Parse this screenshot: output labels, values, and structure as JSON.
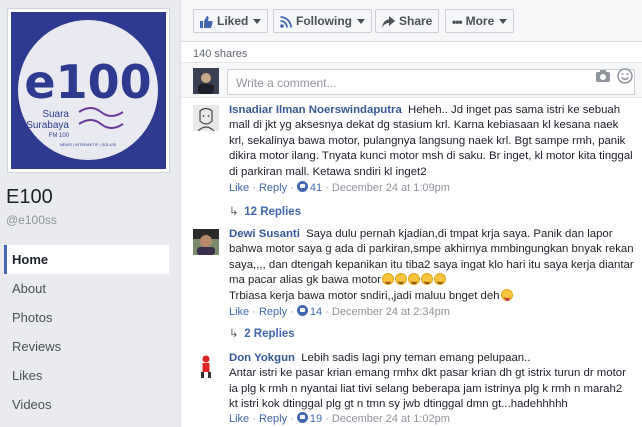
{
  "page": {
    "name": "E100",
    "handle": "@e100ss",
    "logo_text": "e100",
    "logo_sub1": "Suara",
    "logo_sub2": "Surabaya",
    "logo_fm": "FM 100",
    "logo_tag": "NEWS | INTERAKTIF | SOLUSI"
  },
  "nav": {
    "items": [
      {
        "label": "Home",
        "active": true
      },
      {
        "label": "About"
      },
      {
        "label": "Photos"
      },
      {
        "label": "Reviews"
      },
      {
        "label": "Likes"
      },
      {
        "label": "Videos"
      }
    ]
  },
  "actions": {
    "liked": "Liked",
    "following": "Following",
    "share": "Share",
    "more": "More"
  },
  "shares": "140 shares",
  "composer": {
    "placeholder": "Write a comment..."
  },
  "comments": [
    {
      "author": "Isnadiar Ilman Noerswindaputra",
      "text": "Heheh.. Jd inget pas sama istri ke sebuah mall di jkt yg aksesnya dekat dg stasium krl. Karna kebiasaan kl kesana naek krl, sekalinya bawa motor, pulangnya langsung naek krl. Bgt sampe rmh, panik dikira motor ilang. Tnyata kunci motor msh di saku. Br inget, kl motor kita tinggal di parkiran mall. Ketawa sndiri kl inget2",
      "like": "Like",
      "reply": "Reply",
      "likes": "41",
      "date": "December 24 at 1:09pm",
      "replies": "12 Replies"
    },
    {
      "author": "Dewi Susanti",
      "text": "Saya dulu pernah kjadian,di tmpat krja saya. Panik dan lapor bahwa motor saya g ada di parkiran,smpe akhirnya mmbingungkan bnyak rekan saya,,,, dan dtengah kepanikan itu tiba2 saya ingat klo hari itu saya kerja diantar ma pacar alias gk bawa motor",
      "text2": "Trbiasa kerja bawa motor sndiri,,jadi maluu bnget deh",
      "like": "Like",
      "reply": "Reply",
      "likes": "14",
      "date": "December 24 at 2:34pm",
      "replies": "2 Replies"
    },
    {
      "author": "Don Yokgun",
      "text": "Lebih sadis lagi pny teman emang pelupaan..",
      "text2": "Antar istri ke pasar krian emang rmhx dkt pasar krian dh gt istrix turun dr motor ia plg k rmh n nyantai liat tivi selang beberapa jam istrinya plg k rmh n marah2 kt istri kok dtinggal plg gt n tmn sy jwb dtinggal dmn gt...hadehhhhh",
      "like": "Like",
      "reply": "Reply",
      "likes": "19",
      "date": "December 24 at 1:02pm"
    }
  ],
  "colors": {
    "fb_blue": "#4267b2",
    "link": "#365899",
    "logo_bg": "#2d3a8f",
    "logo_circle": "#e9eaf1"
  }
}
